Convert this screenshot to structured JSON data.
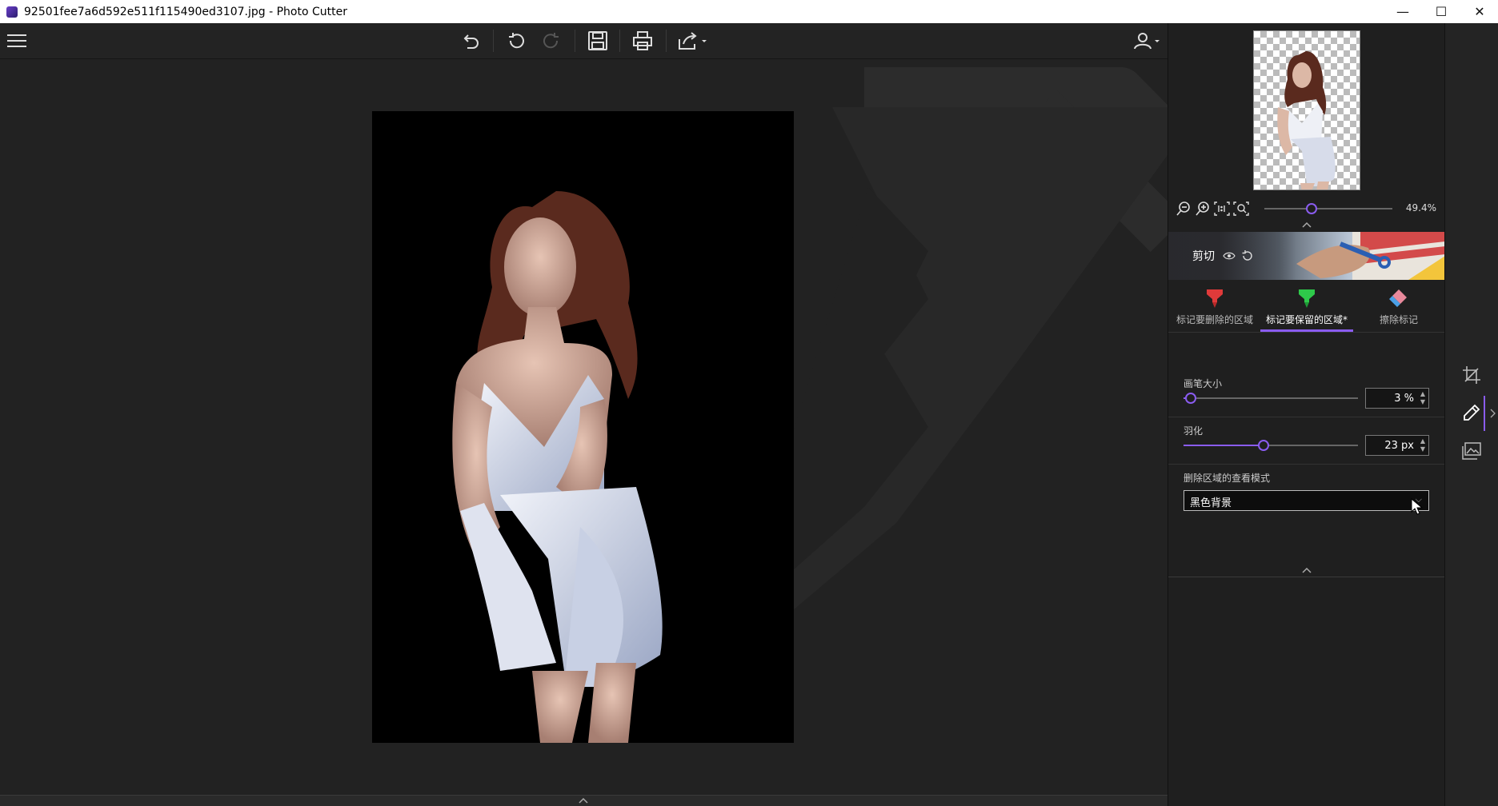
{
  "window": {
    "title": "92501fee7a6d592e511f115490ed3107.jpg - Photo Cutter",
    "minimize": "—",
    "maximize": "☐",
    "close": "✕"
  },
  "toolbar": {
    "icons": [
      "menu-icon",
      "undo-history-icon",
      "undo-icon",
      "redo-icon",
      "save-icon",
      "print-icon",
      "share-icon",
      "user-icon"
    ]
  },
  "preview": {
    "zoom_value": "49.4%",
    "zoom_level": 0.35
  },
  "cut": {
    "label": "剪切"
  },
  "tools": [
    {
      "label": "标记要删除的区域",
      "color": "#e03a3a"
    },
    {
      "label": "标记要保留的区域*",
      "color": "#2ec94a",
      "active": true
    },
    {
      "label": "擦除标记",
      "color": "#4aa0e6"
    }
  ],
  "brush": {
    "label": "画笔大小",
    "value": "3 %",
    "level": 0.03
  },
  "feather": {
    "label": "羽化",
    "value": "23 px",
    "level": 0.39
  },
  "view_mode": {
    "label": "删除区域的查看模式",
    "selected": "黑色背景"
  },
  "accent_color": "#8a5cf0"
}
